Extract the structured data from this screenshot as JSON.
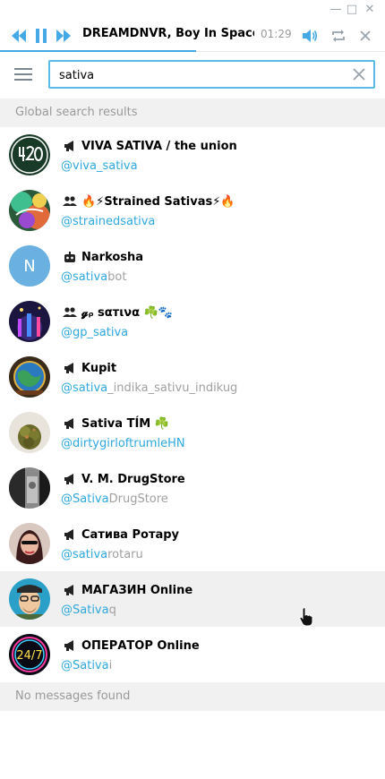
{
  "window": {
    "minimize_glyph": "—",
    "maximize_glyph": "□",
    "close_glyph": "✕"
  },
  "player": {
    "track_title": "DREAMDNVR, Boy In Space – ...",
    "time": "01:29",
    "progress": 0.51,
    "accent_color": "#45a9e6",
    "icons": [
      "rewind-icon",
      "pause-icon",
      "forward-icon",
      "volume-icon",
      "repeat-icon",
      "close-icon"
    ]
  },
  "search": {
    "value": "sativa",
    "placeholder": ""
  },
  "sections": {
    "global": "Global search results",
    "no_messages": "No messages found"
  },
  "results": [
    {
      "type": "channel",
      "name": "VIVA SATIVA / the union",
      "handle_hl": "@viva_sativa",
      "handle_rest": "",
      "avatar": "420-logo"
    },
    {
      "type": "group",
      "name": "🔥⚡Strained Sativas⚡🔥",
      "handle_hl": "@strainedsativa",
      "handle_rest": "",
      "avatar": "colorful-art"
    },
    {
      "type": "bot",
      "name": "Narkosha",
      "handle_hl": "@sativa",
      "handle_rest": "bot",
      "avatar": "letter-N",
      "avatar_letter": "N"
    },
    {
      "type": "group",
      "name": "𝓰ᵨ ѕαтινα ☘️🐾",
      "handle_hl": "@gp_sativa",
      "handle_rest": "",
      "avatar": "night-city"
    },
    {
      "type": "channel",
      "name": "Kupit",
      "handle_hl": "@sativa",
      "handle_rest": "_indika_sativu_indikug",
      "avatar": "globe"
    },
    {
      "type": "channel",
      "name": "Sativa TÍM ☘️",
      "handle_hl": "@dirtygirloftrumleHN",
      "handle_rest": "",
      "avatar": "cannabis-bud"
    },
    {
      "type": "channel",
      "name": "V. M. DrugStore",
      "handle_hl": "@Sativa",
      "handle_rest": "DrugStore",
      "avatar": "dark-photo"
    },
    {
      "type": "channel",
      "name": "Сатива Ротару",
      "handle_hl": "@sativa",
      "handle_rest": "rotaru",
      "avatar": "woman-portrait"
    },
    {
      "type": "channel",
      "name": "МАГАЗИН Online",
      "handle_hl": "@Sativa",
      "handle_rest": "q",
      "avatar": "cartoon-man"
    },
    {
      "type": "channel",
      "name": "ОПЕРАТОР Online",
      "handle_hl": "@Sativa",
      "handle_rest": "i",
      "avatar": "neon-24-7",
      "avatar_text": "24/7"
    }
  ],
  "colors": {
    "link": "#2ea8df",
    "muted": "#a0a0a0",
    "section_bg": "#f1f1f1",
    "input_border": "#57bde4",
    "avatar_N": "#6ab0e0"
  }
}
